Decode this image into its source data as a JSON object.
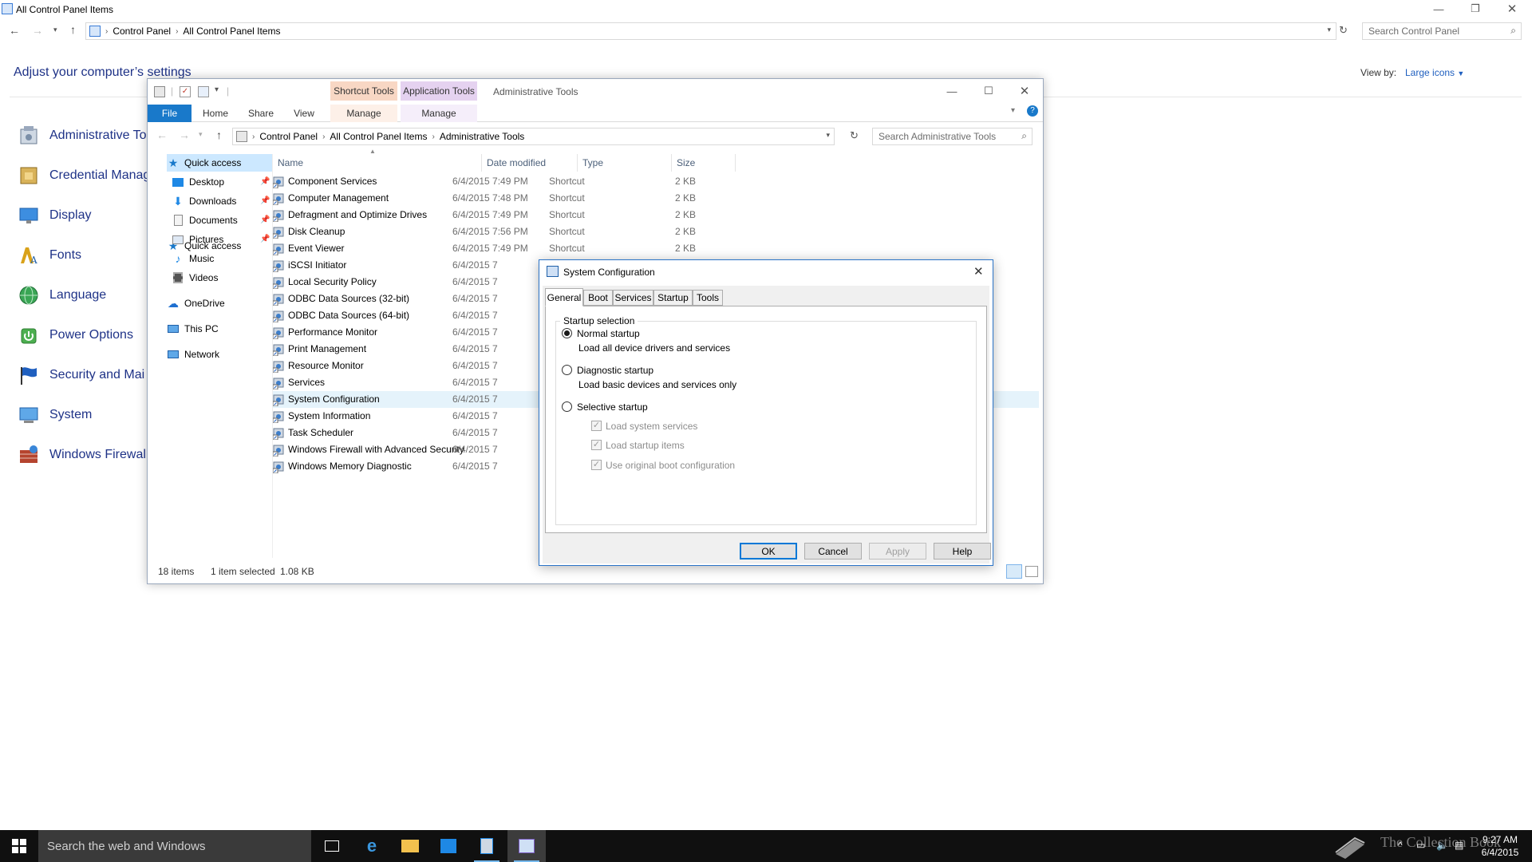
{
  "control_panel": {
    "title": "All Control Panel Items",
    "breadcrumb": [
      "Control Panel",
      "All Control Panel Items"
    ],
    "search_placeholder": "Search Control Panel",
    "heading": "Adjust your computer’s settings",
    "view_by_label": "View by:",
    "view_by_value": "Large icons",
    "items": [
      {
        "label": "Administrative To",
        "icon": "admin-tools-icon"
      },
      {
        "label": "Credential Manag",
        "icon": "credential-manager-icon"
      },
      {
        "label": "Display",
        "icon": "display-icon"
      },
      {
        "label": "Fonts",
        "icon": "fonts-icon"
      },
      {
        "label": "Language",
        "icon": "language-icon"
      },
      {
        "label": "Power Options",
        "icon": "power-options-icon"
      },
      {
        "label": "Security and Mai",
        "icon": "security-flag-icon"
      },
      {
        "label": "System",
        "icon": "system-icon"
      },
      {
        "label": "Windows Firewall",
        "icon": "firewall-icon"
      }
    ]
  },
  "explorer": {
    "context_tabs": {
      "shortcut": "Shortcut Tools",
      "application": "Application Tools"
    },
    "window_title": "Administrative Tools",
    "ribbon_tabs": {
      "file": "File",
      "home": "Home",
      "share": "Share",
      "view": "View",
      "manage1": "Manage",
      "manage2": "Manage"
    },
    "breadcrumb": [
      "Control Panel",
      "All Control Panel Items",
      "Administrative Tools"
    ],
    "search_placeholder": "Search Administrative Tools",
    "nav": {
      "quick_access": "Quick access",
      "desktop": "Desktop",
      "downloads": "Downloads",
      "documents": "Documents",
      "pictures": "Pictures",
      "music": "Music",
      "videos": "Videos",
      "onedrive": "OneDrive",
      "this_pc": "This PC",
      "network": "Network"
    },
    "columns": {
      "name": "Name",
      "date": "Date modified",
      "type": "Type",
      "size": "Size"
    },
    "files": [
      {
        "name": "Component Services",
        "date": "6/4/2015 7:49 PM",
        "type": "Shortcut",
        "size": "2 KB"
      },
      {
        "name": "Computer Management",
        "date": "6/4/2015 7:48 PM",
        "type": "Shortcut",
        "size": "2 KB"
      },
      {
        "name": "Defragment and Optimize Drives",
        "date": "6/4/2015 7:49 PM",
        "type": "Shortcut",
        "size": "2 KB"
      },
      {
        "name": "Disk Cleanup",
        "date": "6/4/2015 7:56 PM",
        "type": "Shortcut",
        "size": "2 KB"
      },
      {
        "name": "Event Viewer",
        "date": "6/4/2015 7:49 PM",
        "type": "Shortcut",
        "size": "2 KB"
      },
      {
        "name": "iSCSI Initiator",
        "date": "6/4/2015 7",
        "type": "",
        "size": ""
      },
      {
        "name": "Local Security Policy",
        "date": "6/4/2015 7",
        "type": "",
        "size": ""
      },
      {
        "name": "ODBC Data Sources (32-bit)",
        "date": "6/4/2015 7",
        "type": "",
        "size": ""
      },
      {
        "name": "ODBC Data Sources (64-bit)",
        "date": "6/4/2015 7",
        "type": "",
        "size": ""
      },
      {
        "name": "Performance Monitor",
        "date": "6/4/2015 7",
        "type": "",
        "size": ""
      },
      {
        "name": "Print Management",
        "date": "6/4/2015 7",
        "type": "",
        "size": ""
      },
      {
        "name": "Resource Monitor",
        "date": "6/4/2015 7",
        "type": "",
        "size": ""
      },
      {
        "name": "Services",
        "date": "6/4/2015 7",
        "type": "",
        "size": ""
      },
      {
        "name": "System Configuration",
        "date": "6/4/2015 7",
        "type": "",
        "size": "",
        "selected": true
      },
      {
        "name": "System Information",
        "date": "6/4/2015 7",
        "type": "",
        "size": ""
      },
      {
        "name": "Task Scheduler",
        "date": "6/4/2015 7",
        "type": "",
        "size": ""
      },
      {
        "name": "Windows Firewall with Advanced Security",
        "date": "6/4/2015 7",
        "type": "",
        "size": ""
      },
      {
        "name": "Windows Memory Diagnostic",
        "date": "6/4/2015 7",
        "type": "",
        "size": ""
      }
    ],
    "status": {
      "count": "18 items",
      "selection": "1 item selected",
      "size": "1.08 KB"
    }
  },
  "msconfig": {
    "title": "System Configuration",
    "tabs": [
      "General",
      "Boot",
      "Services",
      "Startup",
      "Tools"
    ],
    "active_tab": "General",
    "group_label": "Startup selection",
    "options": [
      {
        "label": "Normal startup",
        "desc": "Load all device drivers and services",
        "selected": true
      },
      {
        "label": "Diagnostic startup",
        "desc": "Load basic devices and services only",
        "selected": false
      },
      {
        "label": "Selective startup",
        "desc": "",
        "selected": false
      }
    ],
    "checkboxes": [
      {
        "label": "Load system services",
        "checked": true
      },
      {
        "label": "Load startup items",
        "checked": true
      },
      {
        "label": "Use original boot configuration",
        "checked": true
      }
    ],
    "buttons": {
      "ok": "OK",
      "cancel": "Cancel",
      "apply": "Apply",
      "help": "Help"
    }
  },
  "taskbar": {
    "search_placeholder": "Search the web and Windows",
    "time": "9:27 AM",
    "date": "6/4/2015",
    "watermark": "The Collection Book"
  },
  "colors": {
    "accent": "#0078d7",
    "link_blue": "#1e3287",
    "shortcut_tools_tab": "#f8d7c4",
    "application_tools_tab": "#e5d2f0",
    "selection": "#e5f3fb"
  }
}
